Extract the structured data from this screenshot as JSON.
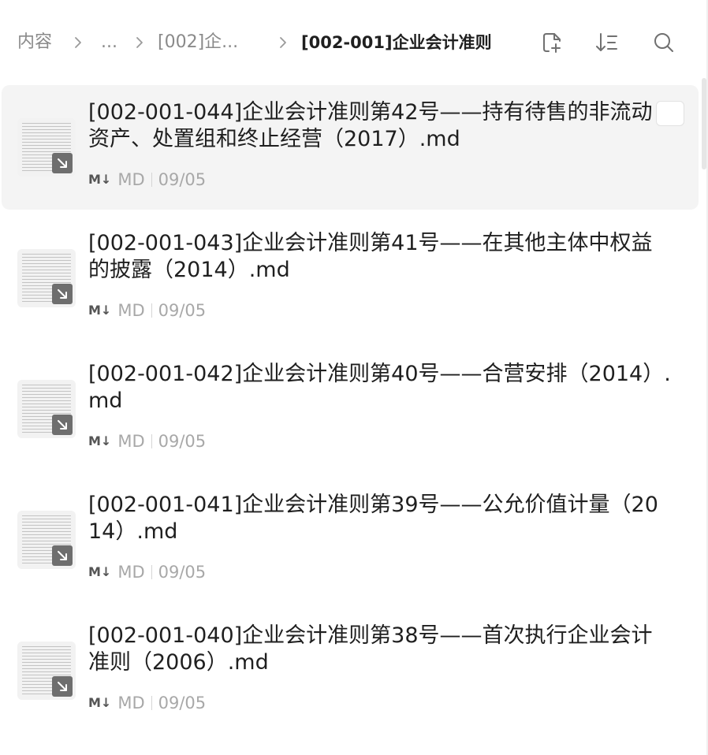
{
  "breadcrumb": {
    "root": "内容",
    "ellipsis": "...",
    "parent": "[002]企...",
    "current": "[002-001]企业会计准则"
  },
  "toolbar": {
    "icons": [
      "new-file-icon",
      "sort-icon",
      "search-icon"
    ]
  },
  "items": [
    {
      "title": "[002-001-044]企业会计准则第42号——持有待售的非流动资产、处置组和终止经营（2017）.md",
      "type": "MD",
      "md_glyph": "M↓",
      "date": "09/05",
      "selected": true
    },
    {
      "title": "[002-001-043]企业会计准则第41号——在其他主体中权益的披露（2014）.md",
      "type": "MD",
      "md_glyph": "M↓",
      "date": "09/05",
      "selected": false
    },
    {
      "title": "[002-001-042]企业会计准则第40号——合营安排（2014）.md",
      "type": "MD",
      "md_glyph": "M↓",
      "date": "09/05",
      "selected": false
    },
    {
      "title": "[002-001-041]企业会计准则第39号——公允价值计量（2014）.md",
      "type": "MD",
      "md_glyph": "M↓",
      "date": "09/05",
      "selected": false
    },
    {
      "title": "[002-001-040]企业会计准则第38号——首次执行企业会计准则（2006）.md",
      "type": "MD",
      "md_glyph": "M↓",
      "date": "09/05",
      "selected": false
    }
  ],
  "colors": {
    "selected_bg": "#f4f4f4",
    "crumb_muted": "#8a8a8a",
    "text_main": "#1f1f1f",
    "meta_text": "#a8a8a8"
  }
}
